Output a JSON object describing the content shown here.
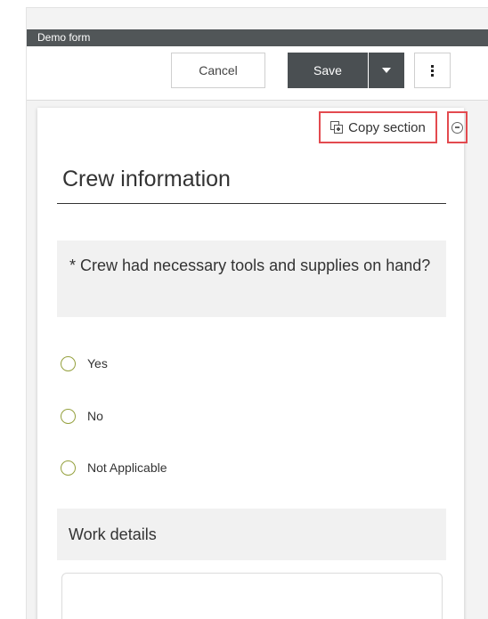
{
  "window": {
    "title": "Demo form"
  },
  "toolbar": {
    "cancel_label": "Cancel",
    "save_label": "Save"
  },
  "section": {
    "copy_label": "Copy section",
    "title": "Crew information"
  },
  "question": {
    "text": "* Crew had necessary tools and supplies on hand?",
    "options": [
      {
        "label": "Yes"
      },
      {
        "label": "No"
      },
      {
        "label": "Not Applicable"
      }
    ]
  },
  "work_details": {
    "label": "Work details",
    "value": ""
  },
  "colors": {
    "titlebar": "#515658",
    "primary_button": "#4a4f52",
    "highlight": "#e34a4f",
    "radio_border": "#94a03d"
  },
  "icons": {
    "copy": "copy-section-icon",
    "collapse": "collapse-circle-minus-icon",
    "dropdown": "caret-down-icon",
    "more": "vertical-dots-icon"
  }
}
